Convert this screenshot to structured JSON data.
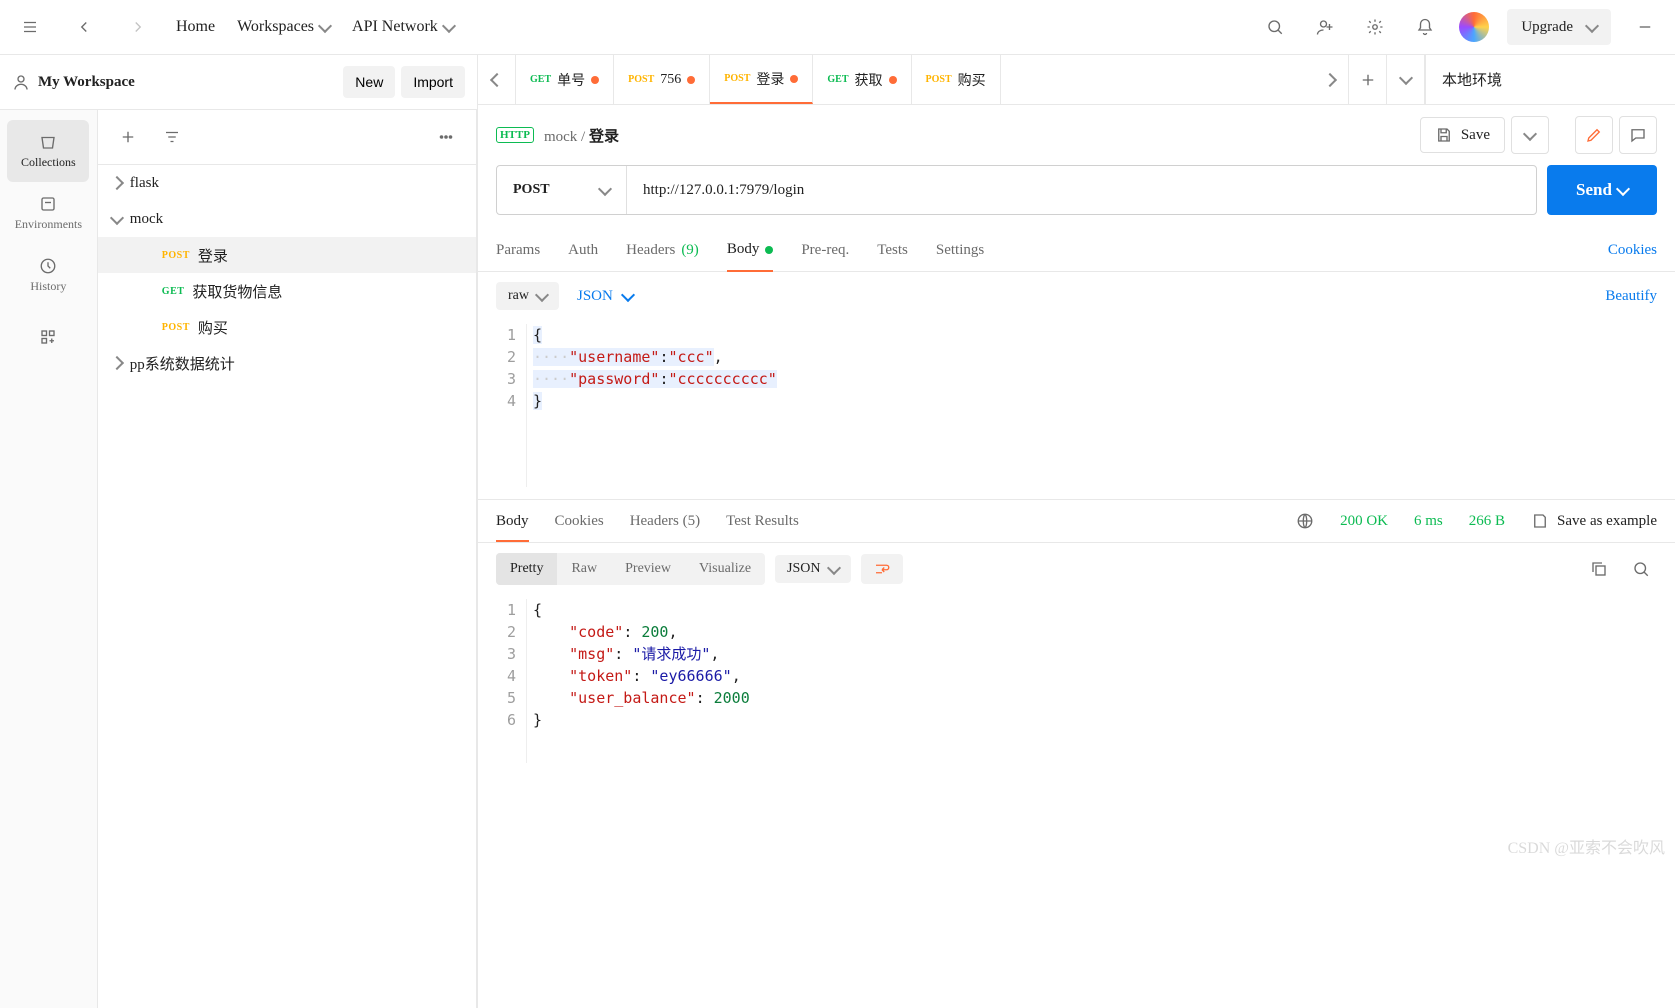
{
  "topbar": {
    "home": "Home",
    "workspaces": "Workspaces",
    "api_network": "API Network",
    "upgrade": "Upgrade"
  },
  "workspace": {
    "title": "My Workspace",
    "new_btn": "New",
    "import_btn": "Import"
  },
  "rail": {
    "collections": "Collections",
    "environments": "Environments",
    "history": "History"
  },
  "tree": {
    "flask": "flask",
    "mock": "mock",
    "login": "登录",
    "get_goods": "获取货物信息",
    "buy": "购买",
    "pp": "pp系统数据统计"
  },
  "tabs": [
    {
      "method": "GET",
      "mclass": "m-GET",
      "label": "单号",
      "dot": true,
      "active": false
    },
    {
      "method": "POST",
      "mclass": "m-POST",
      "label": "756",
      "dot": true,
      "active": false
    },
    {
      "method": "POST",
      "mclass": "m-POST",
      "label": "登录",
      "dot": true,
      "active": true
    },
    {
      "method": "GET",
      "mclass": "m-GET",
      "label": "获取",
      "dot": true,
      "active": false
    },
    {
      "method": "POST",
      "mclass": "m-POST",
      "label": "购买",
      "dot": false,
      "active": false
    }
  ],
  "environment": "本地环境",
  "crumb": {
    "parent": "mock",
    "name": "登录"
  },
  "save_label": "Save",
  "request": {
    "method": "POST",
    "url": "http://127.0.0.1:7979/login",
    "send": "Send"
  },
  "req_tabs": {
    "params": "Params",
    "auth": "Auth",
    "headers": "Headers",
    "headers_count": "(9)",
    "body": "Body",
    "prereq": "Pre-req.",
    "tests": "Tests",
    "settings": "Settings",
    "cookies": "Cookies"
  },
  "body_toolbar": {
    "raw": "raw",
    "json": "JSON",
    "beautify": "Beautify"
  },
  "req_body_lines": [
    "1",
    "2",
    "3",
    "4"
  ],
  "req_body": {
    "k1": "\"username\"",
    "v1": "\"ccc\"",
    "k2": "\"password\"",
    "v2": "\"cccccccccc\""
  },
  "resp_tabs": {
    "body": "Body",
    "cookies": "Cookies",
    "headers": "Headers",
    "headers_count": "(5)",
    "test_results": "Test Results"
  },
  "status": {
    "code": "200 OK",
    "time": "6 ms",
    "size": "266 B",
    "save_example": "Save as example"
  },
  "resp_toolbar": {
    "pretty": "Pretty",
    "raw": "Raw",
    "preview": "Preview",
    "visualize": "Visualize",
    "json": "JSON"
  },
  "resp_lines": [
    "1",
    "2",
    "3",
    "4",
    "5",
    "6"
  ],
  "resp_body": {
    "k1": "\"code\"",
    "v1": "200",
    "k2": "\"msg\"",
    "v2": "\"请求成功\"",
    "k3": "\"token\"",
    "v3": "\"ey66666\"",
    "k4": "\"user_balance\"",
    "v4": "2000"
  },
  "watermark": "CSDN @亚索不会吹风"
}
